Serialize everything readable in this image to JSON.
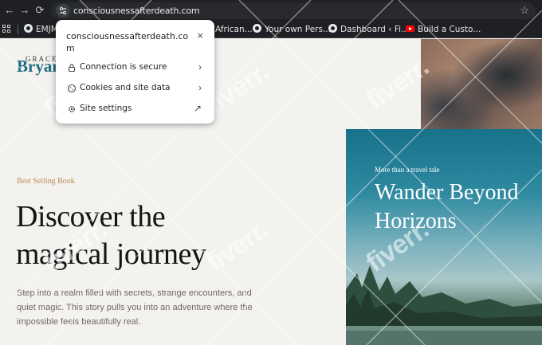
{
  "browser": {
    "url": "consciousnessafterdeath.com",
    "nav": {
      "back": "←",
      "forward": "→",
      "reload": "⟳"
    },
    "bookmarks": [
      {
        "label": "EMJM",
        "icon": "globe-icon"
      },
      {
        "label": "African...",
        "icon": "globe-icon"
      },
      {
        "label": "Your own Pers...",
        "icon": "globe-icon"
      },
      {
        "label": "Dashboard ‹ Fi...",
        "icon": "globe-icon"
      },
      {
        "label": "Build a Custo...",
        "icon": "youtube-icon"
      }
    ]
  },
  "popup": {
    "domain": "consciousnessafterdeath.com",
    "close": "×",
    "rows": [
      {
        "label": "Connection is secure",
        "icon": "lock-icon",
        "trail": "›"
      },
      {
        "label": "Cookies and site data",
        "icon": "cookie-icon",
        "trail": "›"
      },
      {
        "label": "Site settings",
        "icon": "gear-icon",
        "trail": "↗"
      }
    ]
  },
  "page": {
    "logo_small": "GRACE",
    "logo_big": "Bryan",
    "eyebrow": "Best Selling Book",
    "title_line1": "Discover the",
    "title_line2": "magical journey",
    "subtitle": "Step into a realm filled with secrets, strange encounters, and quiet magic. This story pulls you into an adventure where the impossible feels beautifully real."
  },
  "book": {
    "tag": "More than a travel tale",
    "title_line1": "Wander Beyond",
    "title_line2": "Horizons"
  },
  "watermark": "fiverr.",
  "colors": {
    "chrome": "#1f2023",
    "accent_teal": "#1f6f82",
    "eyebrow_gold": "#b88d55"
  }
}
